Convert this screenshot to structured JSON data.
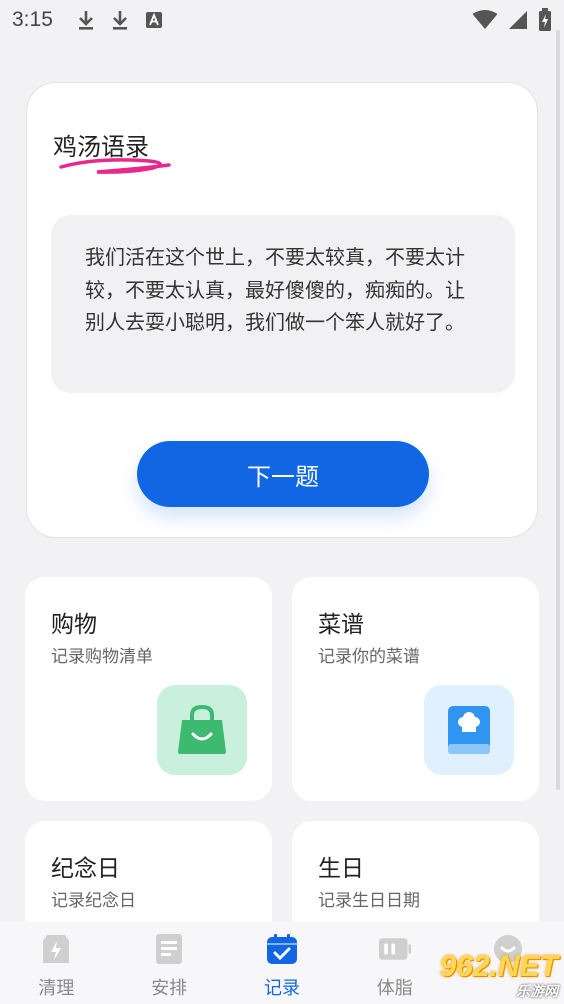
{
  "status_bar": {
    "time": "3:15"
  },
  "quote_card": {
    "title": "鸡汤语录",
    "quote": "我们活在这个世上，不要太较真，不要太计较，不要太认真，最好傻傻的，痴痴的。让别人去耍小聪明，我们做一个笨人就好了。",
    "next_button_label": "下一题"
  },
  "features": [
    {
      "title": "购物",
      "subtitle": "记录购物清单",
      "icon": "shopping-bag-icon",
      "color": "#c9f0dc"
    },
    {
      "title": "菜谱",
      "subtitle": "记录你的菜谱",
      "icon": "recipe-book-icon",
      "color": "#e0f0fe"
    },
    {
      "title": "纪念日",
      "subtitle": "记录纪念日"
    },
    {
      "title": "生日",
      "subtitle": "记录生日日期"
    }
  ],
  "bottom_nav": {
    "items": [
      {
        "label": "清理",
        "icon": "clean-icon"
      },
      {
        "label": "安排",
        "icon": "schedule-icon"
      },
      {
        "label": "记录",
        "icon": "calendar-check-icon",
        "active": true
      },
      {
        "label": "体脂",
        "icon": "body-fat-icon"
      },
      {
        "label": "",
        "icon": "profile-icon"
      }
    ]
  },
  "watermark": {
    "number": "962.NET",
    "text": "乐游网"
  },
  "colors": {
    "accent": "#1167e3",
    "background": "#f2f2f4"
  }
}
